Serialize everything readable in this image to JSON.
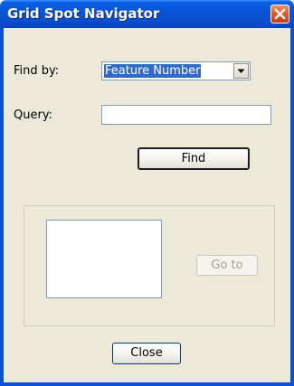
{
  "window": {
    "title": "Grid Spot Navigator"
  },
  "form": {
    "find_by_label": "Find by:",
    "find_by_value": "Feature Number",
    "query_label": "Query:",
    "query_value": "",
    "find_button": "Find"
  },
  "results": {
    "goto_button": "Go to"
  },
  "footer": {
    "close_button": "Close"
  },
  "icons": {
    "close": "close-icon",
    "dropdown": "chevron-down-icon"
  },
  "colors": {
    "titlebar": "#0a52d8",
    "dialog_bg": "#ece9d8",
    "selection": "#316ac5",
    "close_button": "#e45a2c"
  }
}
